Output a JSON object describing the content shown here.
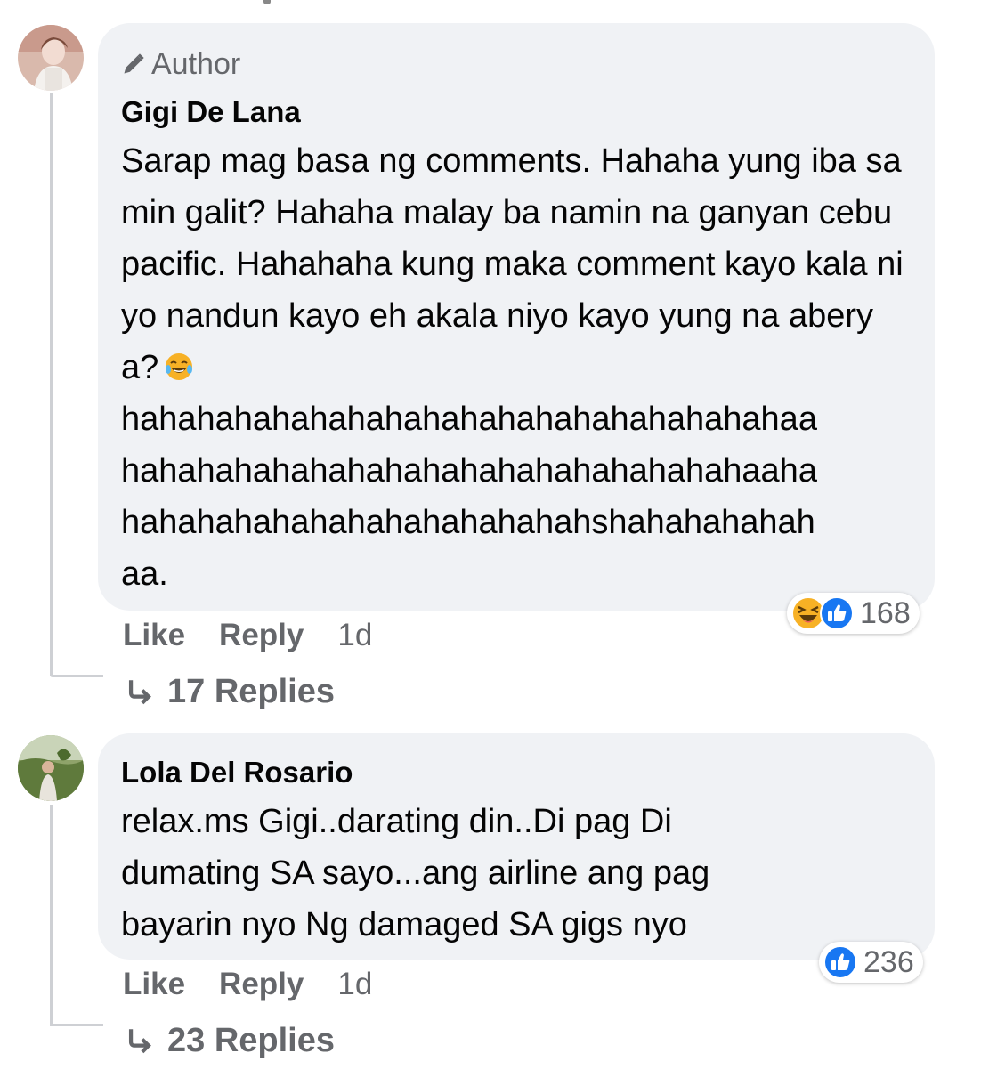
{
  "comments": [
    {
      "badge": "Author",
      "author": "Gigi De Lana",
      "text": "Sarap mag basa ng comments. Hahaha yung iba samin galit? Hahaha malay ba namin na ganyan cebu pacific. Hahahaha kung maka comment kayo kala niyo nandun kayo eh akala niyo kayo yung na aberya?",
      "text_continued": "hahahahahahahahahahahahahahahahahahaa\nhahahahahahahahahahahahahahahahahaaha\nhahahahahahahahahahahahahshahahahahah\naa.",
      "reaction_count": "168",
      "reactions": [
        "laughing-emoji",
        "like-thumb"
      ],
      "like_label": "Like",
      "reply_label": "Reply",
      "time": "1d",
      "replies_label": "17 Replies"
    },
    {
      "author": "Lola Del Rosario",
      "text": "relax.ms Gigi..darating din..Di pag Di dumating SA sayo...ang airline ang pag bayarin nyo Ng damaged SA gigs nyo",
      "reaction_count": "236",
      "reactions": [
        "like-thumb"
      ],
      "like_label": "Like",
      "reply_label": "Reply",
      "time": "1d",
      "replies_label": "23 Replies"
    }
  ],
  "colors": {
    "bubble": "#f0f2f5",
    "secondary_text": "#65676b",
    "primary_text": "#050505",
    "like_blue": "#1877f2",
    "haha_yellow": "#f7b125"
  }
}
